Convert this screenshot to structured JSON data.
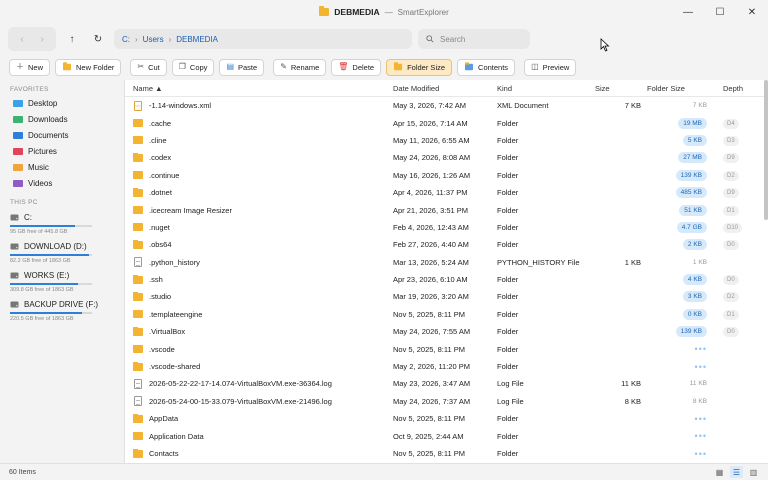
{
  "window": {
    "title": "DEBMEDIA",
    "sep": "—",
    "app": "SmartExplorer",
    "controls": [
      "—",
      "☐",
      "✕"
    ]
  },
  "nav": {
    "back": "‹",
    "forward": "›",
    "up": "↑",
    "refresh": "↻",
    "crumbs": [
      "C:",
      "Users",
      "DEBMEDIA"
    ],
    "search_placeholder": "Search"
  },
  "toolbar": {
    "new": "New",
    "new_folder": "New Folder",
    "cut": "Cut",
    "copy": "Copy",
    "paste": "Paste",
    "rename": "Rename",
    "delete": "Delete",
    "folder_size": "Folder Size",
    "contents": "Contents",
    "preview": "Preview"
  },
  "sidebar": {
    "favorites_label": "FAVORITES",
    "favorites": [
      {
        "label": "Desktop",
        "color": "#3aa0e8"
      },
      {
        "label": "Downloads",
        "color": "#3cb371"
      },
      {
        "label": "Documents",
        "color": "#2f7fd8"
      },
      {
        "label": "Pictures",
        "color": "#e0455a"
      },
      {
        "label": "Music",
        "color": "#f0a53a"
      },
      {
        "label": "Videos",
        "color": "#8e5bc7"
      }
    ],
    "thispc_label": "THIS PC",
    "drives": [
      {
        "label": "C:",
        "free": "95 GB free of 445.8 GB",
        "used_fraction": 0.79
      },
      {
        "label": "DOWNLOAD (D:)",
        "free": "82.2 GB free of 1863 GB",
        "used_fraction": 0.96
      },
      {
        "label": "WORKS (E:)",
        "free": "309.8 GB free of 1863 GB",
        "used_fraction": 0.83
      },
      {
        "label": "BACKUP DRIVE (F:)",
        "free": "220.5 GB free of 1863 GB",
        "used_fraction": 0.88
      }
    ]
  },
  "columns": {
    "name": "Name ▲",
    "date": "Date Modified",
    "kind": "Kind",
    "size": "Size",
    "folder_size": "Folder Size",
    "depth": "Depth"
  },
  "rows": [
    {
      "icon": "xml",
      "name": "-1.14-windows.xml",
      "date": "May 3, 2026, 7:42 AM",
      "kind": "XML Document",
      "size": "7 KB",
      "fsize": "7 KB",
      "fstyle": "plain",
      "depth": ""
    },
    {
      "icon": "folder",
      "name": ".cache",
      "date": "Apr 15, 2026, 7:14 AM",
      "kind": "Folder",
      "size": "",
      "fsize": "19 MB",
      "fstyle": "pill",
      "depth": "D4"
    },
    {
      "icon": "folder",
      "name": ".cline",
      "date": "May 11, 2026, 6:55 AM",
      "kind": "Folder",
      "size": "",
      "fsize": "5 KB",
      "fstyle": "pill",
      "depth": "D3"
    },
    {
      "icon": "folder",
      "name": ".codex",
      "date": "May 24, 2026, 8:08 AM",
      "kind": "Folder",
      "size": "",
      "fsize": "27 MB",
      "fstyle": "pill",
      "depth": "D9"
    },
    {
      "icon": "folder",
      "name": ".continue",
      "date": "May 16, 2026, 1:26 AM",
      "kind": "Folder",
      "size": "",
      "fsize": "139 KB",
      "fstyle": "pill",
      "depth": "D2"
    },
    {
      "icon": "folder",
      "name": ".dotnet",
      "date": "Apr 4, 2026, 11:37 PM",
      "kind": "Folder",
      "size": "",
      "fsize": "485 KB",
      "fstyle": "pill",
      "depth": "D9"
    },
    {
      "icon": "folder",
      "name": ".icecream Image Resizer",
      "date": "Apr 21, 2026, 3:51 PM",
      "kind": "Folder",
      "size": "",
      "fsize": "51 KB",
      "fstyle": "pill",
      "depth": "D1"
    },
    {
      "icon": "folder",
      "name": ".nuget",
      "date": "Feb 4, 2026, 12:43 AM",
      "kind": "Folder",
      "size": "",
      "fsize": "4.7 GB",
      "fstyle": "pill",
      "depth": "D10"
    },
    {
      "icon": "folder",
      "name": ".obs64",
      "date": "Feb 27, 2026, 4:40 AM",
      "kind": "Folder",
      "size": "",
      "fsize": "2 KB",
      "fstyle": "pill",
      "depth": "D0"
    },
    {
      "icon": "doc",
      "name": ".python_history",
      "date": "Mar 13, 2026, 5:24 AM",
      "kind": "PYTHON_HISTORY File",
      "size": "1 KB",
      "fsize": "1 KB",
      "fstyle": "plain",
      "depth": ""
    },
    {
      "icon": "folder",
      "name": ".ssh",
      "date": "Apr 23, 2026, 6:10 AM",
      "kind": "Folder",
      "size": "",
      "fsize": "4 KB",
      "fstyle": "pill",
      "depth": "D0"
    },
    {
      "icon": "folder",
      "name": ".studio",
      "date": "Mar 19, 2026, 3:20 AM",
      "kind": "Folder",
      "size": "",
      "fsize": "3 KB",
      "fstyle": "pill",
      "depth": "D2"
    },
    {
      "icon": "folder",
      "name": ".templateengine",
      "date": "Nov 5, 2025, 8:11 PM",
      "kind": "Folder",
      "size": "",
      "fsize": "0 KB",
      "fstyle": "pill",
      "depth": "D1"
    },
    {
      "icon": "folder",
      "name": ".VirtualBox",
      "date": "May 24, 2026, 7:55 AM",
      "kind": "Folder",
      "size": "",
      "fsize": "139 KB",
      "fstyle": "pill",
      "depth": "D0"
    },
    {
      "icon": "folder",
      "name": ".vscode",
      "date": "Nov 5, 2025, 8:11 PM",
      "kind": "Folder",
      "size": "",
      "fsize": "•••",
      "fstyle": "dots",
      "depth": ""
    },
    {
      "icon": "folder",
      "name": ".vscode-shared",
      "date": "May 2, 2026, 11:20 PM",
      "kind": "Folder",
      "size": "",
      "fsize": "•••",
      "fstyle": "dots",
      "depth": ""
    },
    {
      "icon": "doc",
      "name": "2026-05-22-22-17-14.074-VirtualBoxVM.exe-36364.log",
      "date": "May 23, 2026, 3:47 AM",
      "kind": "Log File",
      "size": "11 KB",
      "fsize": "11 KB",
      "fstyle": "plain",
      "depth": ""
    },
    {
      "icon": "doc",
      "name": "2026-05-24-00-15-33.079-VirtualBoxVM.exe-21496.log",
      "date": "May 24, 2026, 7:37 AM",
      "kind": "Log File",
      "size": "8 KB",
      "fsize": "8 KB",
      "fstyle": "plain",
      "depth": ""
    },
    {
      "icon": "folder",
      "name": "AppData",
      "date": "Nov 5, 2025, 8:11 PM",
      "kind": "Folder",
      "size": "",
      "fsize": "•••",
      "fstyle": "dots",
      "depth": ""
    },
    {
      "icon": "folder",
      "name": "Application Data",
      "date": "Oct 9, 2025, 2:44 AM",
      "kind": "Folder",
      "size": "",
      "fsize": "•••",
      "fstyle": "dots",
      "depth": ""
    },
    {
      "icon": "folder",
      "name": "Contacts",
      "date": "Nov 5, 2025, 8:11 PM",
      "kind": "Folder",
      "size": "",
      "fsize": "•••",
      "fstyle": "dots",
      "depth": ""
    }
  ],
  "status": {
    "items": "60 Items"
  }
}
